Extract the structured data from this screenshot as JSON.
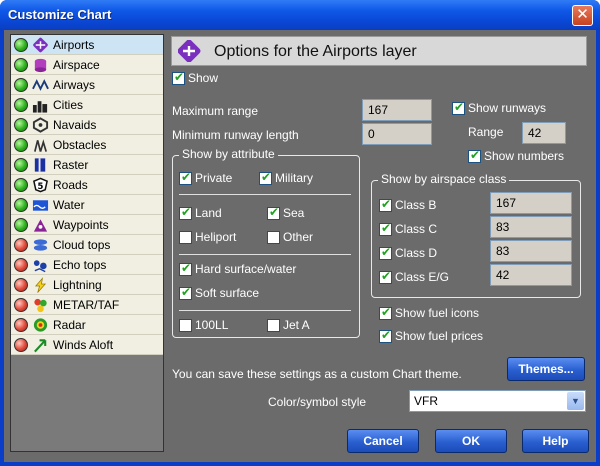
{
  "window": {
    "title": "Customize Chart",
    "close_glyph": "✕"
  },
  "layers": [
    {
      "name": "Airports",
      "status": "green",
      "icon": "airport-icon",
      "selected": true
    },
    {
      "name": "Airspace",
      "status": "green",
      "icon": "airspace-icon",
      "selected": false
    },
    {
      "name": "Airways",
      "status": "green",
      "icon": "airways-icon",
      "selected": false
    },
    {
      "name": "Cities",
      "status": "green",
      "icon": "cities-icon",
      "selected": false
    },
    {
      "name": "Navaids",
      "status": "green",
      "icon": "navaid-icon",
      "selected": false
    },
    {
      "name": "Obstacles",
      "status": "green",
      "icon": "obstacle-icon",
      "selected": false
    },
    {
      "name": "Raster",
      "status": "green",
      "icon": "raster-icon",
      "selected": false
    },
    {
      "name": "Roads",
      "status": "green",
      "icon": "road-icon",
      "selected": false
    },
    {
      "name": "Water",
      "status": "green",
      "icon": "water-icon",
      "selected": false
    },
    {
      "name": "Waypoints",
      "status": "green",
      "icon": "waypoint-icon",
      "selected": false
    },
    {
      "name": "Cloud tops",
      "status": "red",
      "icon": "cloud-icon",
      "selected": false
    },
    {
      "name": "Echo tops",
      "status": "red",
      "icon": "echo-icon",
      "selected": false
    },
    {
      "name": "Lightning",
      "status": "red",
      "icon": "lightning-icon",
      "selected": false
    },
    {
      "name": "METAR/TAF",
      "status": "red",
      "icon": "metar-icon",
      "selected": false
    },
    {
      "name": "Radar",
      "status": "red",
      "icon": "radar-icon",
      "selected": false
    },
    {
      "name": "Winds Aloft",
      "status": "red",
      "icon": "wind-icon",
      "selected": false
    }
  ],
  "header": {
    "title": "Options for the Airports layer",
    "icon": "airport-icon"
  },
  "options": {
    "show": {
      "label": "Show",
      "checked": true
    },
    "max_range": {
      "label": "Maximum range",
      "value": "167"
    },
    "min_runway": {
      "label": "Minimum runway length",
      "value": "0"
    },
    "show_runways": {
      "label": "Show runways",
      "checked": true
    },
    "range": {
      "label": "Range",
      "value": "42"
    },
    "show_numbers": {
      "label": "Show numbers",
      "checked": true
    }
  },
  "attribute_group": {
    "title": "Show by attribute",
    "private": {
      "label": "Private",
      "checked": true
    },
    "military": {
      "label": "Military",
      "checked": true
    },
    "land": {
      "label": "Land",
      "checked": true
    },
    "sea": {
      "label": "Sea",
      "checked": true
    },
    "heliport": {
      "label": "Heliport",
      "checked": false
    },
    "other": {
      "label": "Other",
      "checked": false
    },
    "hard": {
      "label": "Hard surface/water",
      "checked": true
    },
    "soft": {
      "label": "Soft surface",
      "checked": true
    },
    "ll100": {
      "label": "100LL",
      "checked": false
    },
    "jeta": {
      "label": "Jet A",
      "checked": false
    }
  },
  "airspace_group": {
    "title": "Show by airspace class",
    "class_b": {
      "label": "Class B",
      "checked": true,
      "value": "167"
    },
    "class_c": {
      "label": "Class C",
      "checked": true,
      "value": "83"
    },
    "class_d": {
      "label": "Class D",
      "checked": true,
      "value": "83"
    },
    "class_eg": {
      "label": "Class E/G",
      "checked": true,
      "value": "42"
    }
  },
  "fuel": {
    "icons": {
      "label": "Show fuel icons",
      "checked": true
    },
    "prices": {
      "label": "Show fuel prices",
      "checked": true
    }
  },
  "theme": {
    "text": "You can save these settings as a custom Chart theme.",
    "button": "Themes..."
  },
  "style": {
    "label": "Color/symbol style",
    "value": "VFR",
    "arrow": "▼"
  },
  "buttons": {
    "cancel": "Cancel",
    "ok": "OK",
    "help": "Help"
  },
  "colors": {
    "titlebar": "#0a48d6",
    "panel": "#6b6b6b",
    "selected_row": "#cce4f4",
    "check": "#21a121"
  }
}
